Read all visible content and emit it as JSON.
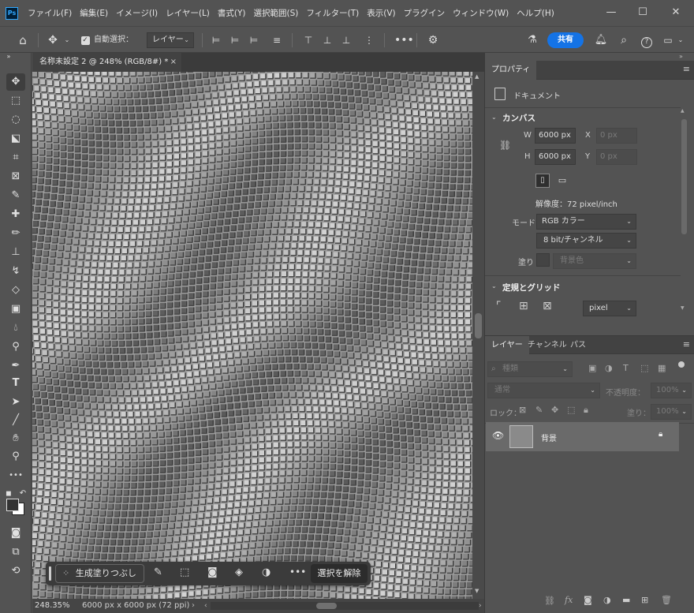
{
  "menubar": {
    "logo": "Ps",
    "items": [
      "ファイル(F)",
      "編集(E)",
      "イメージ(I)",
      "レイヤー(L)",
      "書式(Y)",
      "選択範囲(S)",
      "フィルター(T)",
      "表示(V)",
      "プラグイン",
      "ウィンドウ(W)",
      "ヘルプ(H)"
    ]
  },
  "options": {
    "auto_select_label": "自動選択：",
    "auto_select_target": "レイヤー",
    "share_label": "共有"
  },
  "document": {
    "tab_title": "名称未設定 2 @ 248% (RGB/8#) *"
  },
  "status": {
    "zoom": "248.35%",
    "info": "6000 px x 6000 px (72 ppi)"
  },
  "context_bar": {
    "generative_fill": "生成塗りつぶし",
    "deselect": "選択を解除"
  },
  "properties": {
    "tab_label": "プロパティ",
    "doc_label": "ドキュメント",
    "canvas_title": "カンバス",
    "w_label": "W",
    "w_value": "6000 px",
    "h_label": "H",
    "h_value": "6000 px",
    "x_label": "X",
    "x_value": "0 px",
    "y_label": "Y",
    "y_value": "0 px",
    "resolution": "解像度：72 pixel/inch",
    "mode_label": "モード",
    "mode_value": "RGB カラー",
    "bit_value": "8 bit/チャンネル",
    "fill_label": "塗り",
    "fill_value": "背景色",
    "rulers_title": "定規とグリッド",
    "unit_value": "pixel"
  },
  "layers": {
    "tabs": [
      "レイヤー",
      "チャンネル",
      "パス"
    ],
    "filter_placeholder": "種類",
    "blend_mode": "通常",
    "opacity_label": "不透明度：",
    "opacity_value": "100%",
    "lock_label": "ロック：",
    "fill_label": "塗り：",
    "fill_value": "100%",
    "items": [
      {
        "name": "背景"
      }
    ]
  },
  "colors": {
    "accent": "#1473e6",
    "panel": "#535353",
    "dark": "#3b3b3b"
  }
}
